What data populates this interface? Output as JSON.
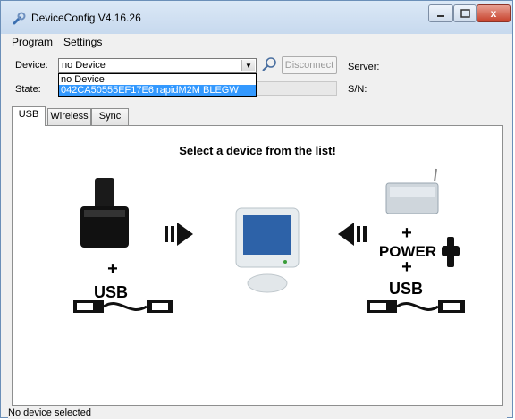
{
  "window": {
    "title": "DeviceConfig V4.16.26",
    "close_glyph": "x"
  },
  "menu": {
    "items": [
      "Program",
      "Settings"
    ]
  },
  "device": {
    "label": "Device:",
    "selected": "no Device",
    "options": [
      "no Device",
      "042CA50555EF17E6 rapidM2M BLEGW"
    ],
    "highlighted_option": 1
  },
  "buttons": {
    "disconnect": "Disconnect"
  },
  "info": {
    "state_label": "State:",
    "server_label": "Server:",
    "sn_label": "S/N:"
  },
  "tabs": [
    {
      "label": "USB",
      "active": true
    },
    {
      "label": "Wireless",
      "active": false
    },
    {
      "label": "Sync",
      "active": false
    }
  ],
  "usb_panel": {
    "heading": "Select a device from the list!",
    "plus": "+",
    "usb_left": "USB",
    "power": "POWER",
    "usb_right": "USB"
  },
  "status_bar": {
    "text": "No device selected"
  },
  "colors": {
    "selection": "#3399ff",
    "title_gradient_top": "#dbe8f6",
    "close_button": "#c7422c"
  },
  "icons": [
    "app-wrench-icon",
    "minimize-icon",
    "maximize-icon",
    "close-icon",
    "search-icon",
    "arrow-right-icon",
    "arrow-left-icon",
    "usb-cable-icon",
    "power-plug-icon"
  ]
}
